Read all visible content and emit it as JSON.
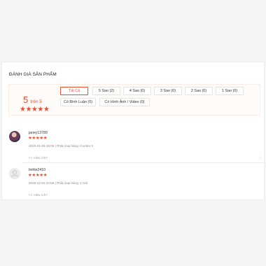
{
  "section": {
    "title": "ĐÁNH GIÁ SẢN PHẨM"
  },
  "rating": {
    "score": "5",
    "out_of": "trên 5",
    "stars": "★★★★★"
  },
  "filters": [
    {
      "label": "Tất Cả",
      "active": true
    },
    {
      "label": "5 Sao (2)"
    },
    {
      "label": "4 Sao (0)"
    },
    {
      "label": "3 Sao (0)"
    },
    {
      "label": "2 Sao (0)"
    },
    {
      "label": "1 Sao (0)"
    },
    {
      "label": "Có Bình Luận (0)"
    },
    {
      "label": "Có Hình Ảnh / Video (0)"
    }
  ],
  "reviews": [
    {
      "username": "janey13789",
      "stars": "★★★★★",
      "meta": "2020-01-09 15:06 | Phân loại hàng: Combo 3",
      "helpful": "Hữu ích?",
      "avatar": "photo"
    },
    {
      "username": "tinhle2410",
      "stars": "★★★★★",
      "meta": "2025-12-02 22:58 | Phân loại hàng: 1 Gói",
      "helpful": "Hữu ích?",
      "avatar": "default"
    }
  ],
  "colors": {
    "accent": "#ee4d2d",
    "overview_bg": "#fffbf8"
  },
  "icons": {
    "helpful": "thumbs-up-icon",
    "more": "more-vertical-icon",
    "default_avatar": "user-silhouette-icon"
  }
}
